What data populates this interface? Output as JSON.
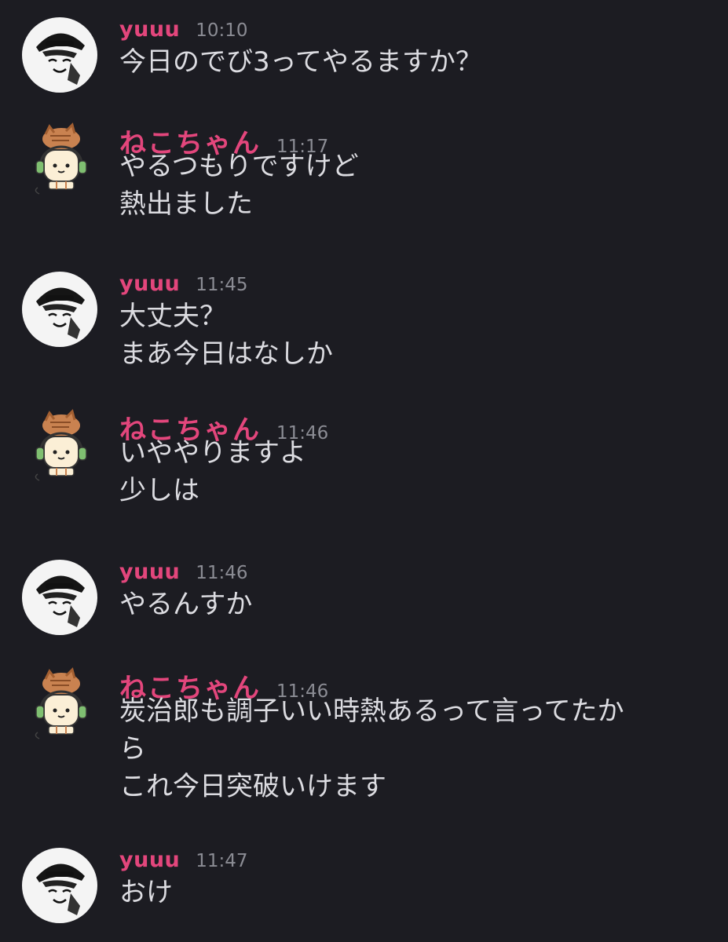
{
  "messages": [
    {
      "author": "yuuu",
      "time": "10:10",
      "lines": [
        "今日のでび3ってやるますか？"
      ]
    },
    {
      "author": "ねこちゃん",
      "time": "11:17",
      "lines": [
        "やるつもりですけど",
        "熱出ました"
      ]
    },
    {
      "author": "yuuu",
      "time": "11:45",
      "lines": [
        "大丈夫？",
        "まあ今日はなしか"
      ]
    },
    {
      "author": "ねこちゃん",
      "time": "11:46",
      "lines": [
        "いややりますよ",
        "少しは"
      ]
    },
    {
      "author": "yuuu",
      "time": "11:46",
      "lines": [
        "やるんすか"
      ]
    },
    {
      "author": "ねこちゃん",
      "time": "11:46",
      "lines": [
        "炭治郎も調子いい時熱あるって言ってたか",
        "ら",
        "これ今日突破いけます"
      ]
    },
    {
      "author": "yuuu",
      "time": "11:47",
      "lines": [
        "おけ"
      ]
    }
  ],
  "colors": {
    "background": "#1c1c22",
    "author_name": "#e3467c",
    "timestamp": "#8b8c94",
    "message_text": "#dcdce1"
  },
  "icons": {
    "yuuu_avatar": "anime-boy-in-cap-avatar-icon",
    "neko_avatar": "cat-with-headphones-avatar-icon"
  }
}
